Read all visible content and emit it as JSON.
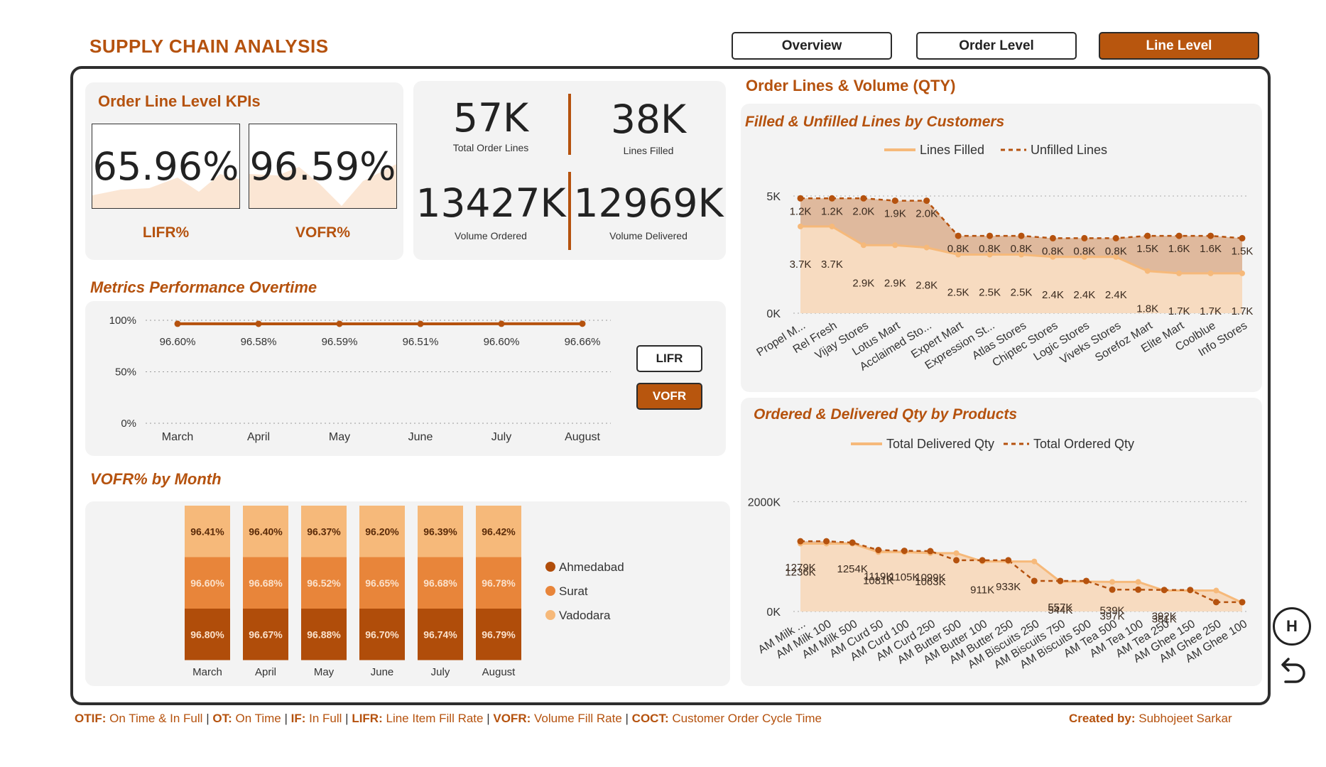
{
  "header": {
    "title": "SUPPLY CHAIN ANALYSIS"
  },
  "nav": {
    "overview": "Overview",
    "order_level": "Order Level",
    "line_level": "Line Level"
  },
  "kpis": {
    "title": "Order Line Level KPIs",
    "lifr_value": "65.96%",
    "lifr_label": "LIFR%",
    "vofr_value": "96.59%",
    "vofr_label": "VOFR%"
  },
  "totals": {
    "total_order_lines": "57K",
    "total_order_lines_label": "Total Order Lines",
    "lines_filled": "38K",
    "lines_filled_label": "Lines Filled",
    "volume_ordered": "13427K",
    "volume_ordered_label": "Volume Ordered",
    "volume_delivered": "12969K",
    "volume_delivered_label": "Volume Delivered"
  },
  "metrics_section": {
    "title": "Metrics Performance Overtime",
    "lifr_button": "LIFR",
    "vofr_button": "VOFR"
  },
  "vofr_section": {
    "title": "VOFR% by Month"
  },
  "right_section": {
    "title": "Order Lines & Volume (QTY)"
  },
  "colors": {
    "accent": "#b5520e",
    "dark": "#b04d0a",
    "mid": "#e8853a",
    "light": "#f6b97a",
    "pale": "#f7d9bd"
  },
  "chart_data": [
    {
      "type": "line",
      "title": "Metrics Performance Overtime",
      "categories": [
        "March",
        "April",
        "May",
        "June",
        "July",
        "August"
      ],
      "values": [
        96.6,
        96.58,
        96.59,
        96.51,
        96.6,
        96.66
      ],
      "labels": [
        "96.60%",
        "96.58%",
        "96.59%",
        "96.51%",
        "96.60%",
        "96.66%"
      ],
      "yticks": [
        "0%",
        "50%",
        "100%"
      ],
      "ylim": [
        0,
        100
      ]
    },
    {
      "type": "bar",
      "title": "VOFR% by Month",
      "categories": [
        "March",
        "April",
        "May",
        "June",
        "July",
        "August"
      ],
      "series": [
        {
          "name": "Ahmedabad",
          "labels": [
            "96.80%",
            "96.67%",
            "96.88%",
            "96.70%",
            "96.74%",
            "96.79%"
          ]
        },
        {
          "name": "Surat",
          "labels": [
            "96.60%",
            "96.68%",
            "96.52%",
            "96.65%",
            "96.68%",
            "96.78%"
          ]
        },
        {
          "name": "Vadodara",
          "labels": [
            "96.41%",
            "96.40%",
            "96.37%",
            "96.20%",
            "96.39%",
            "96.42%"
          ]
        }
      ]
    },
    {
      "type": "area",
      "title": "Filled & Unfilled Lines by Customers",
      "categories": [
        "Propel M...",
        "Rel Fresh",
        "Vijay Stores",
        "Lotus Mart",
        "Acclaimed Sto...",
        "Expert Mart",
        "Expression St...",
        "Atlas Stores",
        "Chiptec Stores",
        "Logic Stores",
        "Viveks Stores",
        "Sorefoz Mart",
        "Elite Mart",
        "Coolblue",
        "Info Stores"
      ],
      "series": [
        {
          "name": "Lines Filled",
          "values": [
            3.7,
            3.7,
            2.9,
            2.9,
            2.8,
            2.5,
            2.5,
            2.5,
            2.4,
            2.4,
            2.4,
            1.8,
            1.7,
            1.7,
            1.7
          ],
          "labels": [
            "3.7K",
            "3.7K",
            "2.9K",
            "2.9K",
            "2.8K",
            "2.5K",
            "2.5K",
            "2.5K",
            "2.4K",
            "2.4K",
            "2.4K",
            "1.8K",
            "1.7K",
            "1.7K",
            "1.7K"
          ]
        },
        {
          "name": "Unfilled Lines",
          "values": [
            1.2,
            1.2,
            2.0,
            1.9,
            2.0,
            0.8,
            0.8,
            0.8,
            0.8,
            0.8,
            0.8,
            1.5,
            1.6,
            1.6,
            1.5
          ],
          "labels": [
            "1.2K",
            "1.2K",
            "2.0K",
            "1.9K",
            "2.0K",
            "0.8K",
            "0.8K",
            "0.8K",
            "0.8K",
            "0.8K",
            "0.8K",
            "1.5K",
            "1.6K",
            "1.6K",
            "1.5K"
          ]
        }
      ],
      "yticks": [
        "0K",
        "5K"
      ],
      "ylim": [
        0,
        5
      ]
    },
    {
      "type": "area",
      "title": "Ordered & Delivered Qty by Products",
      "categories": [
        "AM Milk ...",
        "AM Milk 100",
        "AM Milk 500",
        "AM Curd 50",
        "AM Curd 100",
        "AM Curd 250",
        "AM Butter 500",
        "AM Butter 100",
        "AM Butter 250",
        "AM Biscuits 250",
        "AM Biscuits 750",
        "AM Biscuits 500",
        "AM Tea 500",
        "AM Tea 100",
        "AM Tea 250",
        "AM Ghee 150",
        "AM Ghee 250",
        "AM Ghee 100"
      ],
      "series": [
        {
          "name": "Total Delivered Qty",
          "values": [
            1236,
            1236,
            1236,
            1081,
            1081,
            1063,
            1063,
            911,
            911,
            911,
            544,
            544,
            539,
            539,
            381,
            381,
            381,
            160
          ],
          "labels": [
            "1236K",
            "",
            "",
            "1081K",
            "",
            "1063K",
            "",
            "911K",
            "",
            "",
            "544K",
            "",
            "539K",
            "",
            "381K",
            "",
            "",
            ""
          ]
        },
        {
          "name": "Total Ordered Qty",
          "values": [
            1279,
            1279,
            1254,
            1119,
            1105,
            1099,
            933,
            933,
            933,
            557,
            557,
            557,
            397,
            397,
            392,
            392,
            170,
            170
          ],
          "labels": [
            "1279K",
            "",
            "1254K",
            "1119K",
            "1105K",
            "1099K",
            "",
            "",
            "933K",
            "",
            "557K",
            "",
            "397K",
            "",
            "392K",
            "",
            "",
            ""
          ]
        }
      ],
      "yticks": [
        "0K",
        "2000K"
      ],
      "ylim": [
        0,
        2600
      ]
    }
  ],
  "footer": {
    "otif_key": "OTIF:",
    "otif_val": "On Time & In Full",
    "ot_key": "OT:",
    "ot_val": "On Time",
    "if_key": "IF:",
    "if_val": "In Full",
    "lifr_key": "LIFR:",
    "lifr_val": "Line Item Fill Rate",
    "vofr_key": "VOFR:",
    "vofr_val": "Volume Fill Rate",
    "coct_key": "COCT:",
    "coct_val": "Customer Order Cycle Time",
    "created_key": "Created by:",
    "created_val": "Subhojeet Sarkar"
  },
  "side_buttons": {
    "home": "H"
  }
}
